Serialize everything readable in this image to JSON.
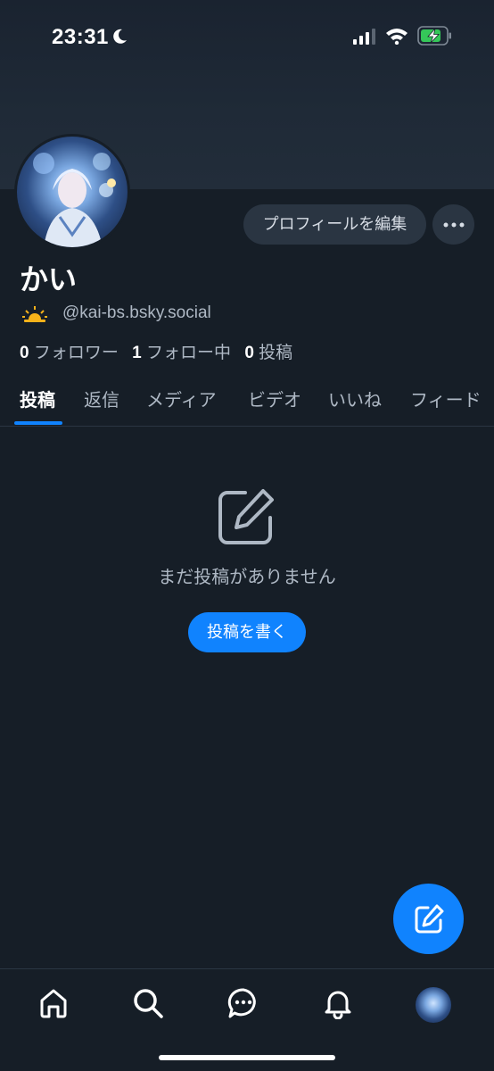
{
  "status_bar": {
    "time": "23:31"
  },
  "profile": {
    "display_name": "かい",
    "handle": "@kai-bs.bsky.social",
    "edit_profile_label": "プロフィールを編集"
  },
  "stats": {
    "followers_count": "0",
    "followers_label": "フォロワー",
    "following_count": "1",
    "following_label": "フォロー中",
    "posts_count": "0",
    "posts_label": "投稿"
  },
  "tabs": [
    {
      "label": "投稿",
      "active": true
    },
    {
      "label": "返信"
    },
    {
      "label": "メディア"
    },
    {
      "label": "ビデオ"
    },
    {
      "label": "いいね"
    },
    {
      "label": "フィード"
    }
  ],
  "empty_state": {
    "message": "まだ投稿がありません",
    "button_label": "投稿を書く"
  },
  "bottom_nav": [
    {
      "icon": "home-icon"
    },
    {
      "icon": "search-icon"
    },
    {
      "icon": "chat-icon"
    },
    {
      "icon": "bell-icon"
    },
    {
      "icon": "profile-avatar"
    }
  ],
  "colors": {
    "background": "#161e27",
    "accent": "#1083fe",
    "muted_text": "#aeb8c4",
    "button_bg": "#2a3542"
  }
}
